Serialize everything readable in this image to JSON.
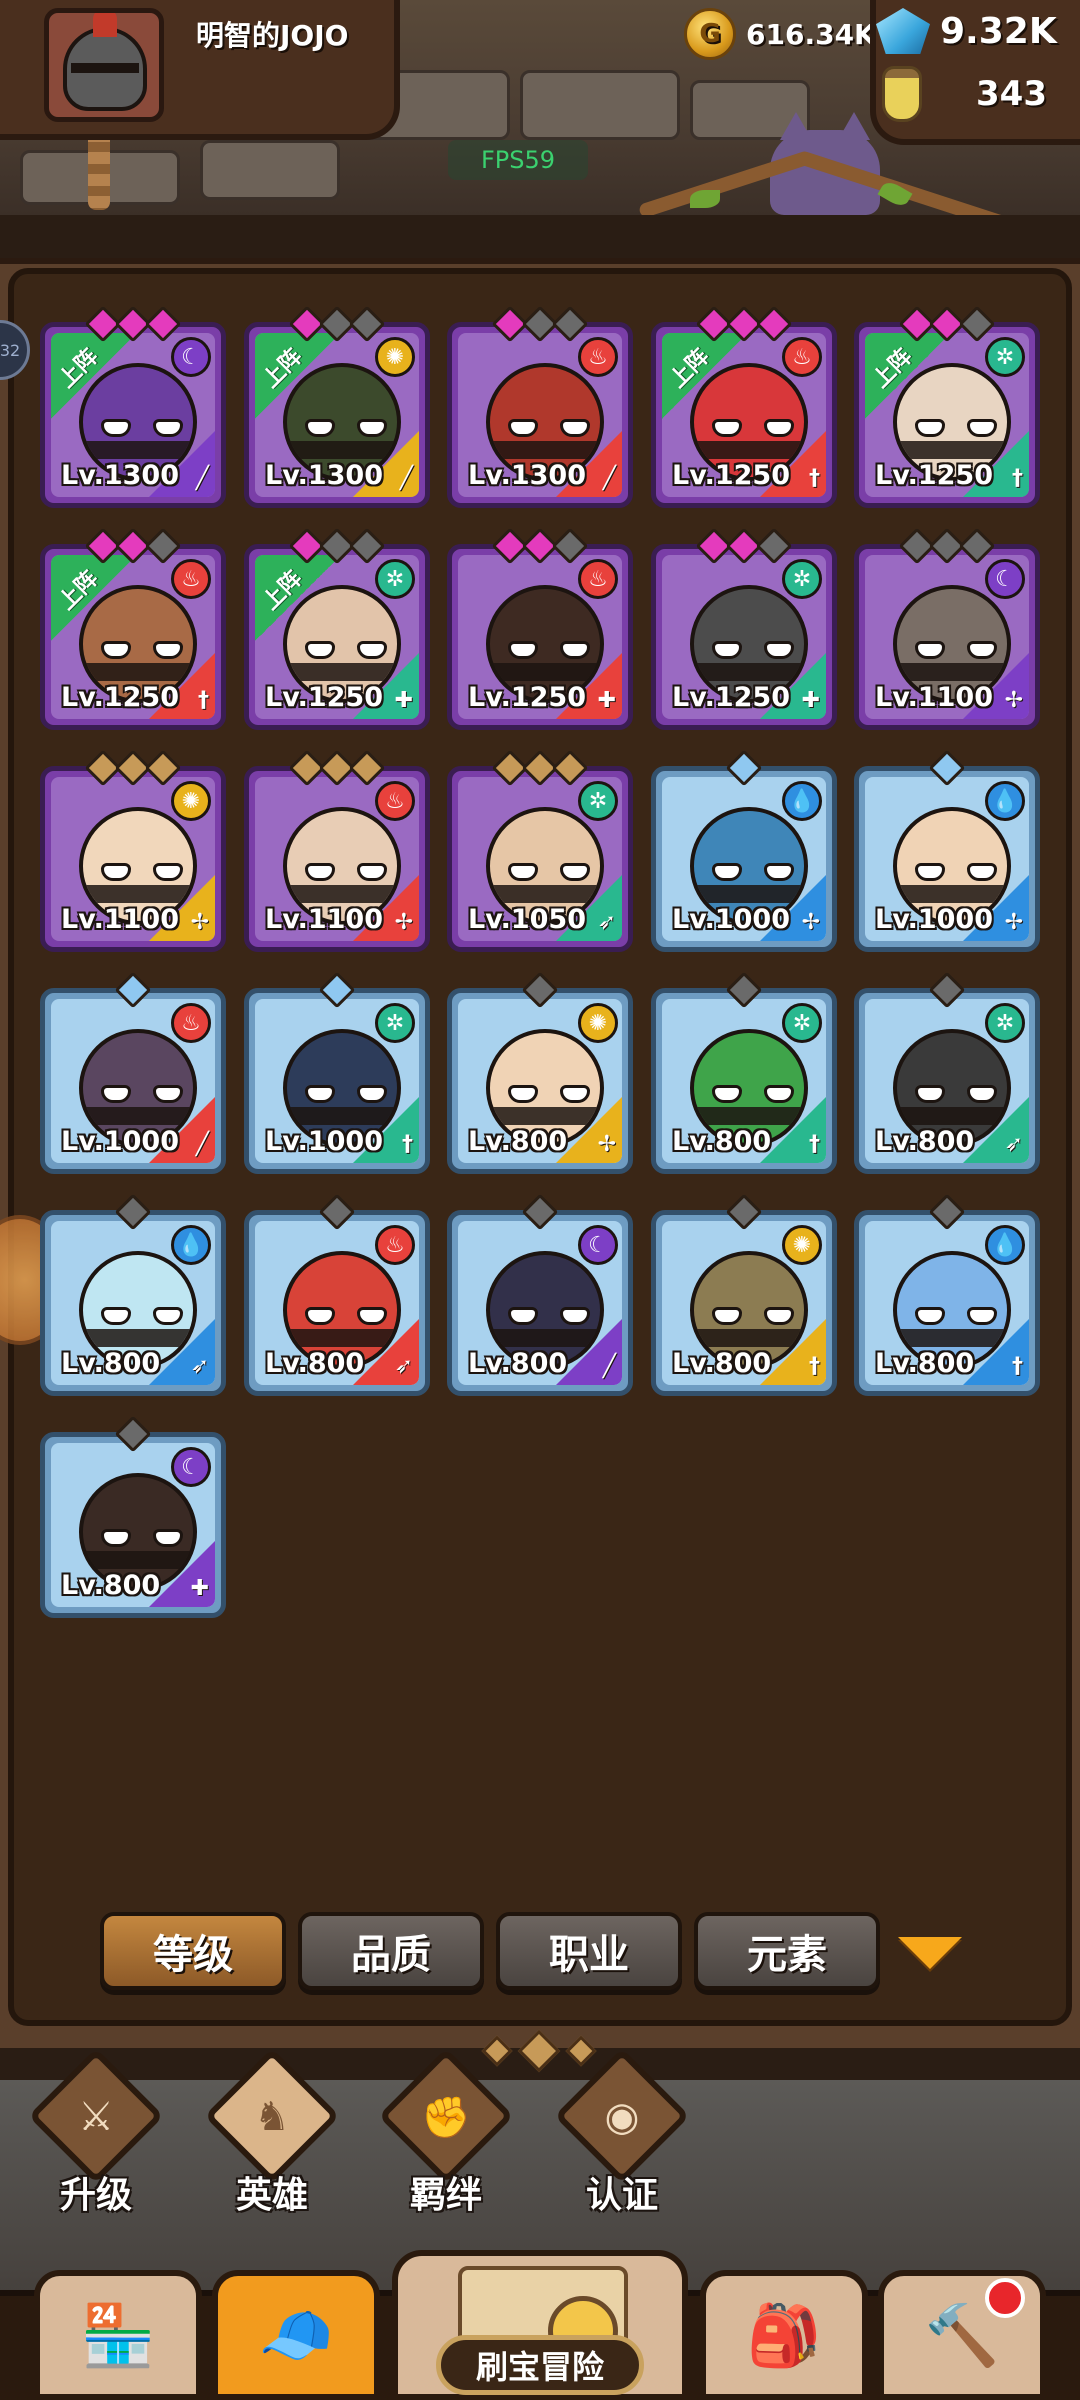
{
  "header": {
    "player_name": "明智的JOJO",
    "gold": "616.34K",
    "gems": "9.32K",
    "potions": "343",
    "fps": "FPS59"
  },
  "side_tab_label": "32",
  "heroes": [
    {
      "level": "Lv.1300",
      "rarity": "purple",
      "stars": [
        "pink",
        "pink",
        "pink"
      ],
      "element": "moon",
      "cls": "mage",
      "deployed": true,
      "skin": "#6b3ea0"
    },
    {
      "level": "Lv.1300",
      "rarity": "purple",
      "stars": [
        "pink",
        "gray",
        "gray"
      ],
      "element": "sun",
      "cls": "mage",
      "deployed": true,
      "skin": "#3c4a2c"
    },
    {
      "level": "Lv.1300",
      "rarity": "purple",
      "stars": [
        "pink",
        "gray",
        "gray"
      ],
      "element": "fire",
      "cls": "mage",
      "deployed": false,
      "skin": "#b0382c"
    },
    {
      "level": "Lv.1250",
      "rarity": "purple",
      "stars": [
        "pink",
        "pink",
        "pink"
      ],
      "element": "fire",
      "cls": "warrior",
      "deployed": true,
      "skin": "#d8373a"
    },
    {
      "level": "Lv.1250",
      "rarity": "purple",
      "stars": [
        "pink",
        "pink",
        "gray"
      ],
      "element": "wind",
      "cls": "warrior",
      "deployed": true,
      "skin": "#e8d5c2"
    },
    {
      "level": "Lv.1250",
      "rarity": "purple",
      "stars": [
        "pink",
        "pink",
        "gray"
      ],
      "element": "fire",
      "cls": "warrior",
      "deployed": true,
      "skin": "#a86a46"
    },
    {
      "level": "Lv.1250",
      "rarity": "purple",
      "stars": [
        "pink",
        "gray",
        "gray"
      ],
      "element": "wind",
      "cls": "tank",
      "deployed": true,
      "skin": "#e2c4aa"
    },
    {
      "level": "Lv.1250",
      "rarity": "purple",
      "stars": [
        "pink",
        "pink",
        "gray"
      ],
      "element": "fire",
      "cls": "tank",
      "deployed": false,
      "skin": "#3e2a22"
    },
    {
      "level": "Lv.1250",
      "rarity": "purple",
      "stars": [
        "pink",
        "pink",
        "gray"
      ],
      "element": "wind",
      "cls": "tank",
      "deployed": false,
      "skin": "#4c4c4c"
    },
    {
      "level": "Lv.1100",
      "rarity": "purple",
      "stars": [
        "gray",
        "gray",
        "gray"
      ],
      "element": "moon",
      "cls": "support",
      "deployed": false,
      "skin": "#7a6e66"
    },
    {
      "level": "Lv.1100",
      "rarity": "purple",
      "stars": [
        "gold",
        "gold",
        "gold"
      ],
      "element": "sun",
      "cls": "support",
      "deployed": false,
      "skin": "#f1d7bb"
    },
    {
      "level": "Lv.1100",
      "rarity": "purple",
      "stars": [
        "gold",
        "gold",
        "gold"
      ],
      "element": "fire",
      "cls": "support",
      "deployed": false,
      "skin": "#e8cdb5"
    },
    {
      "level": "Lv.1050",
      "rarity": "purple",
      "stars": [
        "gold",
        "gold",
        "gold"
      ],
      "element": "wind",
      "cls": "archer",
      "deployed": false,
      "skin": "#e6c6a6"
    },
    {
      "level": "Lv.1000",
      "rarity": "blue",
      "stars": [
        "blue"
      ],
      "element": "water",
      "cls": "support",
      "deployed": false,
      "skin": "#3f86b8"
    },
    {
      "level": "Lv.1000",
      "rarity": "blue",
      "stars": [
        "blue"
      ],
      "element": "water",
      "cls": "support",
      "deployed": false,
      "skin": "#f0d3b5"
    },
    {
      "level": "Lv.1000",
      "rarity": "blue",
      "stars": [
        "blue"
      ],
      "element": "fire",
      "cls": "mage",
      "deployed": false,
      "skin": "#5a4660"
    },
    {
      "level": "Lv.1000",
      "rarity": "blue",
      "stars": [
        "blue"
      ],
      "element": "wind",
      "cls": "warrior",
      "deployed": false,
      "skin": "#2d3c5a"
    },
    {
      "level": "Lv.800",
      "rarity": "blue",
      "stars": [
        "gray"
      ],
      "element": "sun",
      "cls": "support",
      "deployed": false,
      "skin": "#f0d3b5"
    },
    {
      "level": "Lv.800",
      "rarity": "blue",
      "stars": [
        "gray"
      ],
      "element": "wind",
      "cls": "warrior",
      "deployed": false,
      "skin": "#3fa44a"
    },
    {
      "level": "Lv.800",
      "rarity": "blue",
      "stars": [
        "gray"
      ],
      "element": "wind",
      "cls": "archer",
      "deployed": false,
      "skin": "#3a3a3a"
    },
    {
      "level": "Lv.800",
      "rarity": "blue",
      "stars": [
        "gray"
      ],
      "element": "water",
      "cls": "archer",
      "deployed": false,
      "skin": "#bfe6f2"
    },
    {
      "level": "Lv.800",
      "rarity": "blue",
      "stars": [
        "gray"
      ],
      "element": "fire",
      "cls": "archer",
      "deployed": false,
      "skin": "#d84338"
    },
    {
      "level": "Lv.800",
      "rarity": "blue",
      "stars": [
        "gray"
      ],
      "element": "moon",
      "cls": "mage",
      "deployed": false,
      "skin": "#32304a"
    },
    {
      "level": "Lv.800",
      "rarity": "blue",
      "stars": [
        "gray"
      ],
      "element": "sun",
      "cls": "warrior",
      "deployed": false,
      "skin": "#8c7c52"
    },
    {
      "level": "Lv.800",
      "rarity": "blue",
      "stars": [
        "gray"
      ],
      "element": "water",
      "cls": "warrior",
      "deployed": false,
      "skin": "#7fb4e8"
    },
    {
      "level": "Lv.800",
      "rarity": "blue",
      "stars": [
        "gray"
      ],
      "element": "moon",
      "cls": "tank",
      "deployed": false,
      "skin": "#3a2a24"
    }
  ],
  "deployed_label": "上阵",
  "filters": [
    {
      "label": "等级",
      "active": true
    },
    {
      "label": "品质",
      "active": false
    },
    {
      "label": "职业",
      "active": false
    },
    {
      "label": "元素",
      "active": false
    }
  ],
  "nav": [
    {
      "label": "升级",
      "icon": "sword-icon",
      "active": false
    },
    {
      "label": "英雄",
      "icon": "hero-icon",
      "active": true
    },
    {
      "label": "羁绊",
      "icon": "handshake-icon",
      "active": false
    },
    {
      "label": "认证",
      "icon": "eye-icon",
      "active": false
    }
  ],
  "dock": {
    "center_label": "刷宝冒险"
  },
  "colors": {
    "purple_rarity": "#7a3ea8",
    "blue_rarity": "#6e9cc2",
    "deploy_green": "#2db15a",
    "active_tab": "#c4873f"
  }
}
